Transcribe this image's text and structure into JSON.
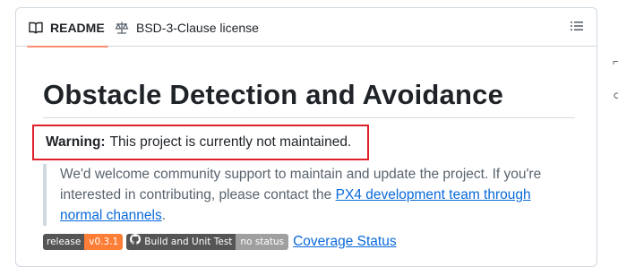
{
  "tabs": {
    "readme_label": "README",
    "license_label": "BSD-3-Clause license"
  },
  "heading": "Obstacle Detection and Avoidance",
  "warning": {
    "bold": "Warning:",
    "text": "This project is currently not maintained."
  },
  "quote": {
    "text_before": "We'd welcome community support to maintain and update the project. If you're interested in contributing, please contact the ",
    "link": "PX4 development team through normal channels",
    "text_after": "."
  },
  "badges": [
    {
      "left": "release",
      "right": "v0.3.1",
      "right_color": "#fe7d37"
    },
    {
      "left": "Build and Unit Test",
      "right": "no status",
      "right_color": "#9f9f9f",
      "icon": "github-icon"
    }
  ],
  "coverage_link": "Coverage Status",
  "colors": {
    "warning_border": "#e0202a",
    "link": "#0969da",
    "active_tab_underline": "#fd8c73"
  }
}
